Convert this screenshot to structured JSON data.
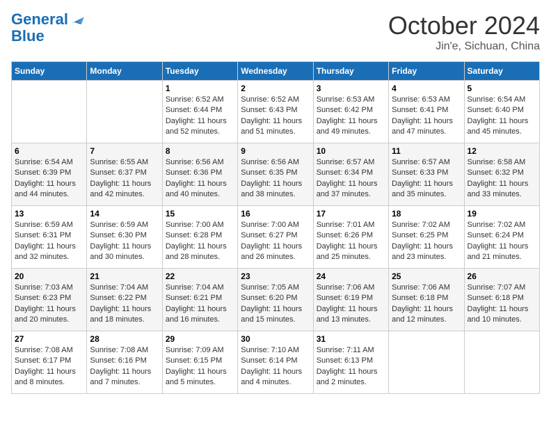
{
  "header": {
    "logo_line1": "General",
    "logo_line2": "Blue",
    "month": "October 2024",
    "location": "Jin'e, Sichuan, China"
  },
  "days_of_week": [
    "Sunday",
    "Monday",
    "Tuesday",
    "Wednesday",
    "Thursday",
    "Friday",
    "Saturday"
  ],
  "weeks": [
    [
      {
        "day": "",
        "sunrise": "",
        "sunset": "",
        "daylight": ""
      },
      {
        "day": "",
        "sunrise": "",
        "sunset": "",
        "daylight": ""
      },
      {
        "day": "1",
        "sunrise": "Sunrise: 6:52 AM",
        "sunset": "Sunset: 6:44 PM",
        "daylight": "Daylight: 11 hours and 52 minutes."
      },
      {
        "day": "2",
        "sunrise": "Sunrise: 6:52 AM",
        "sunset": "Sunset: 6:43 PM",
        "daylight": "Daylight: 11 hours and 51 minutes."
      },
      {
        "day": "3",
        "sunrise": "Sunrise: 6:53 AM",
        "sunset": "Sunset: 6:42 PM",
        "daylight": "Daylight: 11 hours and 49 minutes."
      },
      {
        "day": "4",
        "sunrise": "Sunrise: 6:53 AM",
        "sunset": "Sunset: 6:41 PM",
        "daylight": "Daylight: 11 hours and 47 minutes."
      },
      {
        "day": "5",
        "sunrise": "Sunrise: 6:54 AM",
        "sunset": "Sunset: 6:40 PM",
        "daylight": "Daylight: 11 hours and 45 minutes."
      }
    ],
    [
      {
        "day": "6",
        "sunrise": "Sunrise: 6:54 AM",
        "sunset": "Sunset: 6:39 PM",
        "daylight": "Daylight: 11 hours and 44 minutes."
      },
      {
        "day": "7",
        "sunrise": "Sunrise: 6:55 AM",
        "sunset": "Sunset: 6:37 PM",
        "daylight": "Daylight: 11 hours and 42 minutes."
      },
      {
        "day": "8",
        "sunrise": "Sunrise: 6:56 AM",
        "sunset": "Sunset: 6:36 PM",
        "daylight": "Daylight: 11 hours and 40 minutes."
      },
      {
        "day": "9",
        "sunrise": "Sunrise: 6:56 AM",
        "sunset": "Sunset: 6:35 PM",
        "daylight": "Daylight: 11 hours and 38 minutes."
      },
      {
        "day": "10",
        "sunrise": "Sunrise: 6:57 AM",
        "sunset": "Sunset: 6:34 PM",
        "daylight": "Daylight: 11 hours and 37 minutes."
      },
      {
        "day": "11",
        "sunrise": "Sunrise: 6:57 AM",
        "sunset": "Sunset: 6:33 PM",
        "daylight": "Daylight: 11 hours and 35 minutes."
      },
      {
        "day": "12",
        "sunrise": "Sunrise: 6:58 AM",
        "sunset": "Sunset: 6:32 PM",
        "daylight": "Daylight: 11 hours and 33 minutes."
      }
    ],
    [
      {
        "day": "13",
        "sunrise": "Sunrise: 6:59 AM",
        "sunset": "Sunset: 6:31 PM",
        "daylight": "Daylight: 11 hours and 32 minutes."
      },
      {
        "day": "14",
        "sunrise": "Sunrise: 6:59 AM",
        "sunset": "Sunset: 6:30 PM",
        "daylight": "Daylight: 11 hours and 30 minutes."
      },
      {
        "day": "15",
        "sunrise": "Sunrise: 7:00 AM",
        "sunset": "Sunset: 6:28 PM",
        "daylight": "Daylight: 11 hours and 28 minutes."
      },
      {
        "day": "16",
        "sunrise": "Sunrise: 7:00 AM",
        "sunset": "Sunset: 6:27 PM",
        "daylight": "Daylight: 11 hours and 26 minutes."
      },
      {
        "day": "17",
        "sunrise": "Sunrise: 7:01 AM",
        "sunset": "Sunset: 6:26 PM",
        "daylight": "Daylight: 11 hours and 25 minutes."
      },
      {
        "day": "18",
        "sunrise": "Sunrise: 7:02 AM",
        "sunset": "Sunset: 6:25 PM",
        "daylight": "Daylight: 11 hours and 23 minutes."
      },
      {
        "day": "19",
        "sunrise": "Sunrise: 7:02 AM",
        "sunset": "Sunset: 6:24 PM",
        "daylight": "Daylight: 11 hours and 21 minutes."
      }
    ],
    [
      {
        "day": "20",
        "sunrise": "Sunrise: 7:03 AM",
        "sunset": "Sunset: 6:23 PM",
        "daylight": "Daylight: 11 hours and 20 minutes."
      },
      {
        "day": "21",
        "sunrise": "Sunrise: 7:04 AM",
        "sunset": "Sunset: 6:22 PM",
        "daylight": "Daylight: 11 hours and 18 minutes."
      },
      {
        "day": "22",
        "sunrise": "Sunrise: 7:04 AM",
        "sunset": "Sunset: 6:21 PM",
        "daylight": "Daylight: 11 hours and 16 minutes."
      },
      {
        "day": "23",
        "sunrise": "Sunrise: 7:05 AM",
        "sunset": "Sunset: 6:20 PM",
        "daylight": "Daylight: 11 hours and 15 minutes."
      },
      {
        "day": "24",
        "sunrise": "Sunrise: 7:06 AM",
        "sunset": "Sunset: 6:19 PM",
        "daylight": "Daylight: 11 hours and 13 minutes."
      },
      {
        "day": "25",
        "sunrise": "Sunrise: 7:06 AM",
        "sunset": "Sunset: 6:18 PM",
        "daylight": "Daylight: 11 hours and 12 minutes."
      },
      {
        "day": "26",
        "sunrise": "Sunrise: 7:07 AM",
        "sunset": "Sunset: 6:18 PM",
        "daylight": "Daylight: 11 hours and 10 minutes."
      }
    ],
    [
      {
        "day": "27",
        "sunrise": "Sunrise: 7:08 AM",
        "sunset": "Sunset: 6:17 PM",
        "daylight": "Daylight: 11 hours and 8 minutes."
      },
      {
        "day": "28",
        "sunrise": "Sunrise: 7:08 AM",
        "sunset": "Sunset: 6:16 PM",
        "daylight": "Daylight: 11 hours and 7 minutes."
      },
      {
        "day": "29",
        "sunrise": "Sunrise: 7:09 AM",
        "sunset": "Sunset: 6:15 PM",
        "daylight": "Daylight: 11 hours and 5 minutes."
      },
      {
        "day": "30",
        "sunrise": "Sunrise: 7:10 AM",
        "sunset": "Sunset: 6:14 PM",
        "daylight": "Daylight: 11 hours and 4 minutes."
      },
      {
        "day": "31",
        "sunrise": "Sunrise: 7:11 AM",
        "sunset": "Sunset: 6:13 PM",
        "daylight": "Daylight: 11 hours and 2 minutes."
      },
      {
        "day": "",
        "sunrise": "",
        "sunset": "",
        "daylight": ""
      },
      {
        "day": "",
        "sunrise": "",
        "sunset": "",
        "daylight": ""
      }
    ]
  ]
}
